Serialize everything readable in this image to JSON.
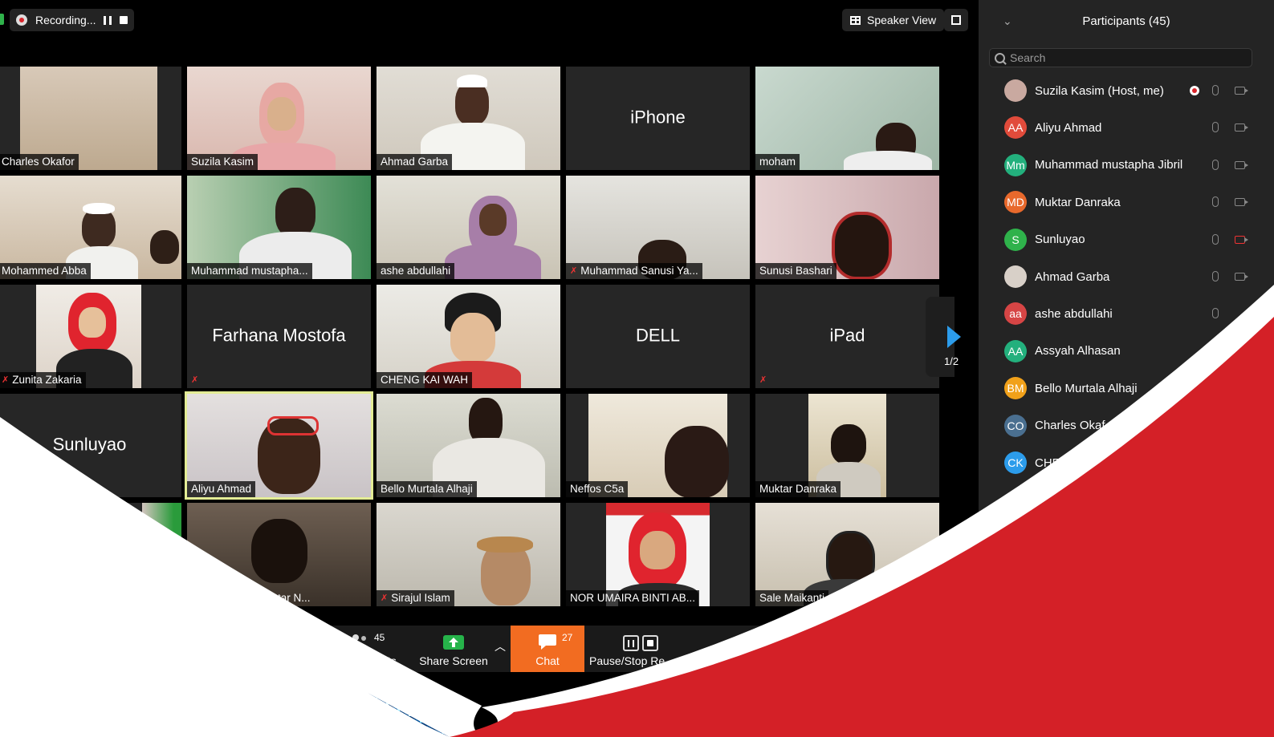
{
  "recording": {
    "label": "Recording..."
  },
  "header": {
    "speaker_view": "Speaker View"
  },
  "tiles": [
    {
      "name": "Charles Okafor"
    },
    {
      "name": "Suzila Kasim"
    },
    {
      "name": "Ahmad Garba"
    },
    {
      "name": "iPhone"
    },
    {
      "name": "moham"
    },
    {
      "name": "Mohammed Abba"
    },
    {
      "name": "Muhammad mustapha..."
    },
    {
      "name": "ashe abdullahi"
    },
    {
      "name": "Muhammad Sanusi Ya..."
    },
    {
      "name": "Sunusi Bashari"
    },
    {
      "name": "Zunita Zakaria"
    },
    {
      "name": "Farhana Mostofa"
    },
    {
      "name": "CHENG KAI WAH"
    },
    {
      "name": "DELL"
    },
    {
      "name": "iPad"
    },
    {
      "name": "Sunluyao"
    },
    {
      "name": "Aliyu Ahmad"
    },
    {
      "name": "Bello Murtala Alhaji"
    },
    {
      "name": "Neffos C5a"
    },
    {
      "name": "Muktar Danraka"
    },
    {
      "name": ""
    },
    {
      "name": "Mukhtar N..."
    },
    {
      "name": "Sirajul Islam"
    },
    {
      "name": "NOR UMAIRA BINTI AB..."
    },
    {
      "name": "Sale Maikanti"
    }
  ],
  "pagination": "1/2",
  "toolbar": {
    "participants_count": "45",
    "participants_label": "icipants",
    "share_label": "Share Screen",
    "chat_count": "27",
    "chat_label": "Chat",
    "pause_label": "Pause/Stop Re"
  },
  "sidebar": {
    "title": "Participants (45)",
    "search_placeholder": "Search",
    "participants": [
      {
        "initials": "",
        "name": "Suzila Kasim (Host, me)",
        "color": "#c9a9a0"
      },
      {
        "initials": "AA",
        "name": "Aliyu Ahmad",
        "color": "#e14b3b"
      },
      {
        "initials": "Mm",
        "name": "Muhammad mustapha Jibril",
        "color": "#23b07d"
      },
      {
        "initials": "MD",
        "name": "Muktar Danraka",
        "color": "#e8692c"
      },
      {
        "initials": "S",
        "name": "Sunluyao",
        "color": "#2fb24b"
      },
      {
        "initials": "",
        "name": "Ahmad Garba",
        "color": "#d8d0c8"
      },
      {
        "initials": "aa",
        "name": "ashe abdullahi",
        "color": "#d64545"
      },
      {
        "initials": "AA",
        "name": "Assyah Alhasan",
        "color": "#23b07d"
      },
      {
        "initials": "BM",
        "name": "Bello Murtala Alhaji",
        "color": "#f1a11a"
      },
      {
        "initials": "CO",
        "name": "Charles Okaf",
        "color": "#4a6f90"
      },
      {
        "initials": "CK",
        "name": "CHE",
        "color": "#2c9ceb"
      }
    ]
  },
  "colors": {
    "accent_chat": "#f26c21",
    "select_border": "#e3ec95",
    "brand_red": "#d42027",
    "next_arrow": "#2c9ceb"
  }
}
